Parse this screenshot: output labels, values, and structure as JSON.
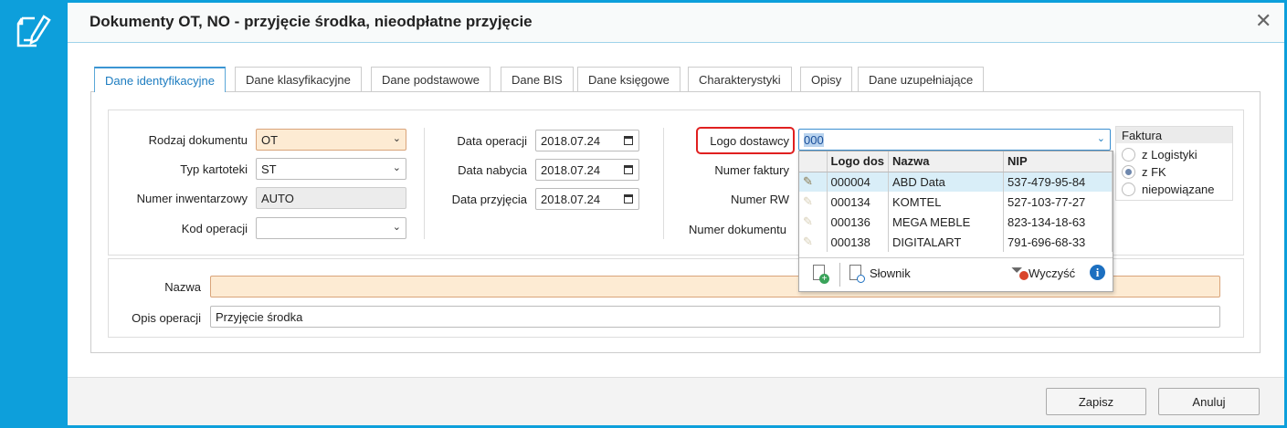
{
  "window": {
    "title": "Dokumenty OT, NO - przyjęcie środka, nieodpłatne przyjęcie",
    "close": "✕"
  },
  "tabs": [
    "Dane identyfikacyjne",
    "Dane klasyfikacyjne",
    "Dane podstawowe",
    "Dane BIS",
    "Dane księgowe",
    "Charakterystyki",
    "Opisy",
    "Dane uzupełniające"
  ],
  "form": {
    "rodzaj_label": "Rodzaj dokumentu",
    "rodzaj_value": "OT",
    "typ_label": "Typ kartoteki",
    "typ_value": "ST",
    "numer_inw_label": "Numer inwentarzowy",
    "numer_inw_value": "AUTO",
    "kod_label": "Kod operacji",
    "kod_value": "",
    "data_op_label": "Data operacji",
    "data_op_value": "2018.07.24",
    "data_nab_label": "Data nabycia",
    "data_nab_value": "2018.07.24",
    "data_przy_label": "Data przyjęcia",
    "data_przy_value": "2018.07.24",
    "logo_label": "Logo dostawcy",
    "logo_value": "000",
    "numer_faktury_label": "Numer faktury",
    "numer_rw_label": "Numer RW",
    "numer_dok_label": "Numer dokumentu",
    "nazwa_label": "Nazwa",
    "nazwa_value": "",
    "opis_label": "Opis operacji",
    "opis_value": "Przyjęcie środka"
  },
  "faktura": {
    "title": "Faktura",
    "options": [
      "z Logistyki",
      "z FK",
      "niepowiązane"
    ],
    "selected": "z FK"
  },
  "dropdown": {
    "columns": [
      "Logo dos",
      "Nazwa",
      "NIP"
    ],
    "rows": [
      {
        "logo": "000004",
        "nazwa": "ABD Data",
        "nip": "537-479-95-84"
      },
      {
        "logo": "000134",
        "nazwa": "KOMTEL",
        "nip": "527-103-77-27"
      },
      {
        "logo": "000136",
        "nazwa": "MEGA MEBLE",
        "nip": "823-134-18-63"
      },
      {
        "logo": "000138",
        "nazwa": "DIGITALART",
        "nip": "791-696-68-33"
      }
    ],
    "slownik": "Słownik",
    "wyczysc": "Wyczyść",
    "info": "i"
  },
  "footer": {
    "save": "Zapisz",
    "cancel": "Anuluj"
  },
  "colors": {
    "accent": "#0d9fdb",
    "required": "#fdebd3",
    "highlight": "#e02020"
  }
}
